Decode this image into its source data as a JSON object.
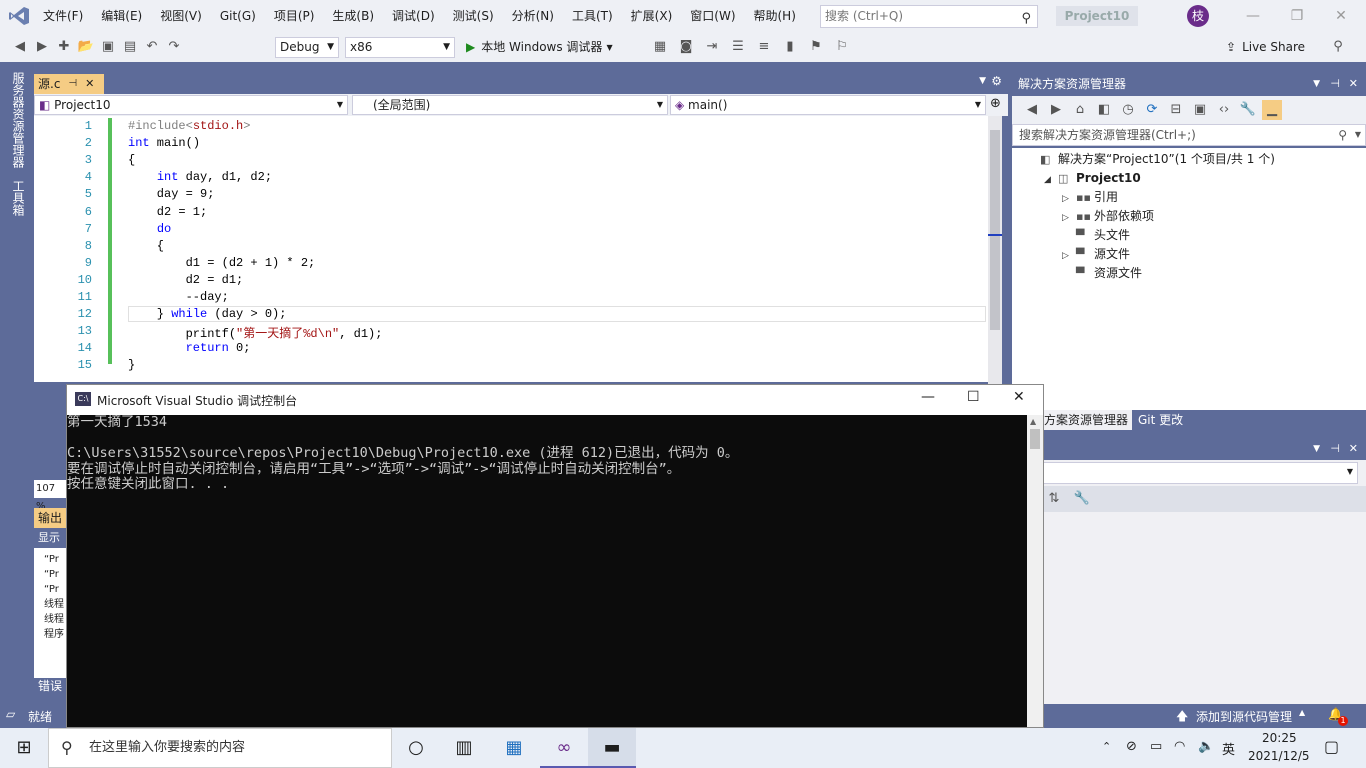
{
  "menu": [
    "文件(F)",
    "编辑(E)",
    "视图(V)",
    "Git(G)",
    "项目(P)",
    "生成(B)",
    "调试(D)",
    "测试(S)",
    "分析(N)",
    "工具(T)",
    "扩展(X)",
    "窗口(W)",
    "帮助(H)"
  ],
  "search": {
    "placeholder": "搜索 (Ctrl+Q)"
  },
  "solution_title": "Project10",
  "avatar_initial": "枝",
  "toolbar": {
    "config": "Debug",
    "platform": "x86",
    "run_label": "本地 Windows 调试器",
    "liveshare": "Live Share"
  },
  "side_tabs": [
    "服务器资源管理器",
    "工具箱"
  ],
  "editor": {
    "tab_name": "源.c",
    "nav_project": "Project10",
    "nav_scope": "(全局范围)",
    "nav_member": "main()",
    "zoom": "107 %",
    "lines": [
      {
        "n": "1",
        "html": "<span class='pre'>#include&lt;</span><span class='str'>stdio.h</span><span class='pre'>&gt;</span>"
      },
      {
        "n": "2",
        "html": "<span class='kw'>int</span> main()"
      },
      {
        "n": "3",
        "html": "{"
      },
      {
        "n": "4",
        "html": "    <span class='kw'>int</span> day, d1, d2;"
      },
      {
        "n": "5",
        "html": "    day = 9;"
      },
      {
        "n": "6",
        "html": "    d2 = 1;"
      },
      {
        "n": "7",
        "html": "    <span class='kw'>do</span>"
      },
      {
        "n": "8",
        "html": "    {"
      },
      {
        "n": "9",
        "html": "        d1 = (d2 + 1) * 2;"
      },
      {
        "n": "10",
        "html": "        d2 = d1;"
      },
      {
        "n": "11",
        "html": "        --day;"
      },
      {
        "n": "12",
        "html": "    } <span class='kw'>while</span> (day &gt; 0);"
      },
      {
        "n": "13",
        "html": "        printf(<span class='str'>\"第一天摘了%d\\n\"</span>, d1);"
      },
      {
        "n": "14",
        "html": "        <span class='kw'>return</span> 0;"
      },
      {
        "n": "15",
        "html": "}"
      }
    ]
  },
  "output": {
    "tab": "输出",
    "show": "显示",
    "lines": [
      "“Pr",
      "“Pr",
      "“Pr",
      "线程",
      "线程",
      "程序"
    ],
    "error_tab": "错误"
  },
  "solution_explorer": {
    "header": "解决方案资源管理器",
    "search_placeholder": "搜索解决方案资源管理器(Ctrl+;)",
    "tree": [
      {
        "label": "解决方案“Project10”(1 个项目/共 1 个)",
        "level": 0,
        "tri": "",
        "icon": "◧"
      },
      {
        "label": "Project10",
        "level": 1,
        "tri": "◢",
        "icon": "◫",
        "bold": true
      },
      {
        "label": "引用",
        "level": 2,
        "tri": "▷",
        "icon": "▪▪"
      },
      {
        "label": "外部依赖项",
        "level": 2,
        "tri": "▷",
        "icon": "▪▪"
      },
      {
        "label": "头文件",
        "level": 2,
        "tri": "",
        "icon": "▀"
      },
      {
        "label": "源文件",
        "level": 2,
        "tri": "▷",
        "icon": "▀"
      },
      {
        "label": "资源文件",
        "level": 2,
        "tri": "",
        "icon": "▀"
      }
    ],
    "tabs": [
      "方案资源管理器",
      "Git 更改"
    ]
  },
  "status": {
    "left": "就绪",
    "right": "添加到源代码管理",
    "badge": "1"
  },
  "console": {
    "title": "Microsoft Visual Studio 调试控制台",
    "text": "第一天摘了1534\n\nC:\\Users\\31552\\source\\repos\\Project10\\Debug\\Project10.exe (进程 612)已退出，代码为 0。\n要在调试停止时自动关闭控制台，请启用“工具”->“选项”->“调试”->“调试停止时自动关闭控制台”。\n按任意键关闭此窗口. . ."
  },
  "taskbar": {
    "search_placeholder": "在这里输入你要搜索的内容",
    "ime": "英",
    "time": "20:25",
    "date": "2021/12/5"
  }
}
